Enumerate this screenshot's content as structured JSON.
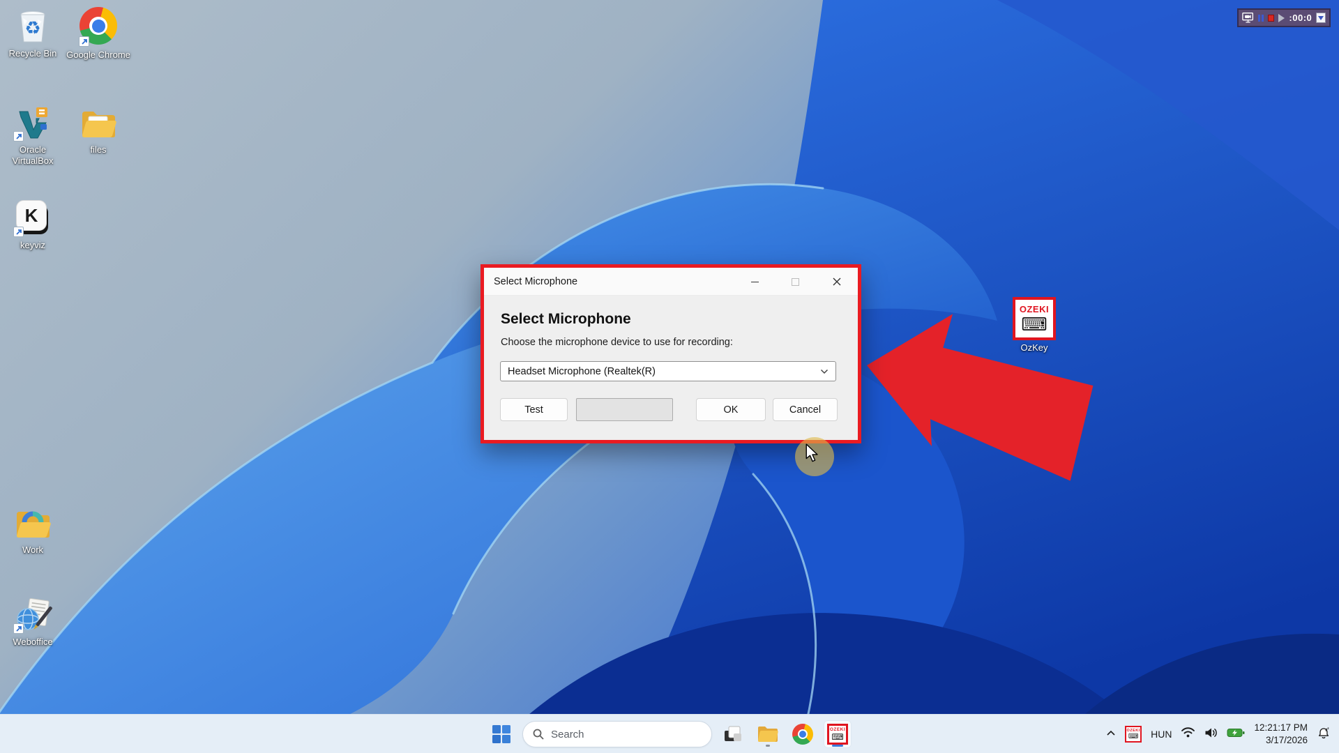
{
  "recorder": {
    "timer": ":00:0",
    "icons": [
      "screen-record-icon",
      "pause-icon",
      "stop-icon",
      "play-icon",
      "dropdown-arrow-icon"
    ]
  },
  "desktop": {
    "icons": [
      {
        "id": "recycle-bin",
        "label": "Recycle Bin"
      },
      {
        "id": "google-chrome",
        "label": "Google Chrome"
      },
      {
        "id": "oracle-virtualbox",
        "label": "Oracle VirtualBox"
      },
      {
        "id": "files",
        "label": "files"
      },
      {
        "id": "keyviz",
        "label": "keyviz"
      },
      {
        "id": "work",
        "label": "Work"
      },
      {
        "id": "weboffice",
        "label": "Weboffice"
      },
      {
        "id": "ozkey",
        "label": "OzKey"
      }
    ],
    "keyviz_letter": "K",
    "ozeki_text": "OZEKI",
    "ozeki_keyboard_glyph": "⌨"
  },
  "dialog": {
    "window_title": "Select Microphone",
    "heading": "Select Microphone",
    "description": "Choose the microphone device to use for recording:",
    "dropdown_value": "Headset Microphone (Realtek(R)",
    "test_label": "Test",
    "ok_label": "OK",
    "cancel_label": "Cancel"
  },
  "taskbar": {
    "search_placeholder": "Search"
  },
  "tray": {
    "language": "HUN",
    "time": "12:21:17 PM",
    "date": "3/17/2026"
  },
  "colors": {
    "annotation_red": "#ea1b22",
    "taskbar_bg": "#e5eef7",
    "battery_green": "#3fa23c",
    "recorder_bg": "#5b4c74"
  }
}
